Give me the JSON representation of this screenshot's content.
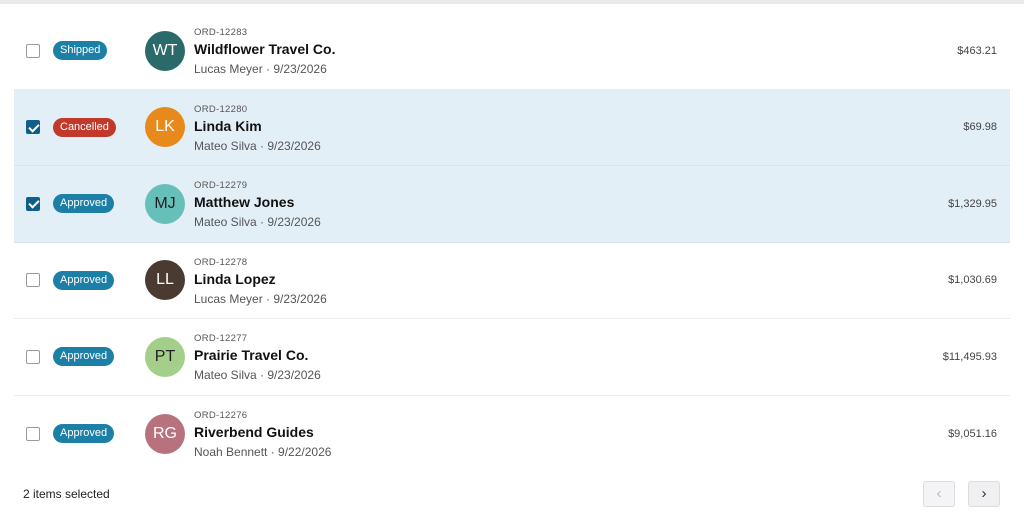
{
  "orders": [
    {
      "id": "ORD-12283",
      "name": "Wildflower Travel Co.",
      "rep": "Lucas Meyer",
      "date": "9/23/2026",
      "meta": "Lucas Meyer · 9/23/2026",
      "status": "Shipped",
      "status_color": "#1c7fa6",
      "initials": "WT",
      "avatar_color": "#2b6a6a",
      "amount": "$463.21",
      "selected": false
    },
    {
      "id": "ORD-12280",
      "name": "Linda Kim",
      "rep": "Mateo Silva",
      "date": "9/23/2026",
      "meta": "Mateo Silva · 9/23/2026",
      "status": "Cancelled",
      "status_color": "#c0392b",
      "initials": "LK",
      "avatar_color": "#e8891c",
      "amount": "$69.98",
      "selected": true
    },
    {
      "id": "ORD-12279",
      "name": "Matthew Jones",
      "rep": "Mateo Silva",
      "date": "9/23/2026",
      "meta": "Mateo Silva · 9/23/2026",
      "status": "Approved",
      "status_color": "#1c7fa6",
      "initials": "MJ",
      "avatar_color": "#67bfba",
      "amount": "$1,329.95",
      "selected": true
    },
    {
      "id": "ORD-12278",
      "name": "Linda Lopez",
      "rep": "Lucas Meyer",
      "date": "9/23/2026",
      "meta": "Lucas Meyer · 9/23/2026",
      "status": "Approved",
      "status_color": "#1c7fa6",
      "initials": "LL",
      "avatar_color": "#4b3a30",
      "amount": "$1,030.69",
      "selected": false
    },
    {
      "id": "ORD-12277",
      "name": "Prairie Travel Co.",
      "rep": "Mateo Silva",
      "date": "9/23/2026",
      "meta": "Mateo Silva · 9/23/2026",
      "status": "Approved",
      "status_color": "#1c7fa6",
      "initials": "PT",
      "avatar_color": "#a3cf8a",
      "amount": "$11,495.93",
      "selected": false
    },
    {
      "id": "ORD-12276",
      "name": "Riverbend Guides",
      "rep": "Noah Bennett",
      "date": "9/22/2026",
      "meta": "Noah Bennett · 9/22/2026",
      "status": "Approved",
      "status_color": "#1c7fa6",
      "initials": "RG",
      "avatar_color": "#b8727d",
      "amount": "$9,051.16",
      "selected": false
    }
  ],
  "footer": {
    "selection_text": "2 items selected",
    "prev_icon": "chevron-left-icon",
    "next_icon": "chevron-right-icon"
  }
}
